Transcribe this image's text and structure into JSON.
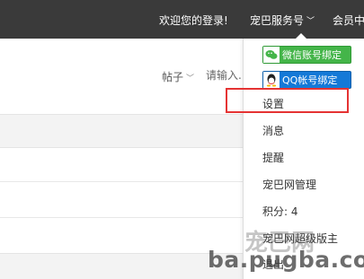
{
  "topbar": {
    "welcome_text": "欢迎您的登录!",
    "service_label": "宠巴服务号",
    "member_label": "会员中"
  },
  "search": {
    "type_label": "帖子",
    "placeholder": "请输入..."
  },
  "dropdown": {
    "wechat_bind_label": "微信账号绑定",
    "qq_bind_label": "QQ帐号绑定",
    "items": [
      {
        "label": "设置"
      },
      {
        "label": "消息"
      },
      {
        "label": "提醒"
      },
      {
        "label": "宠巴网管理"
      },
      {
        "label": "积分: 4"
      },
      {
        "label": "宠巴网超级版主"
      },
      {
        "label": "退出"
      }
    ]
  },
  "watermark": {
    "line1": "宠巴网",
    "line2": "ba.pugba.com"
  },
  "colors": {
    "topbar_bg": "#3a3a3a",
    "wechat_green": "#44b549",
    "qq_blue": "#1479d7",
    "highlight_red": "#e53333"
  }
}
